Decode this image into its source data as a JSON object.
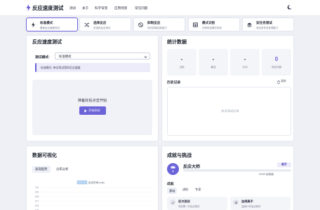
{
  "header": {
    "title": "反应速度测试",
    "nav": [
      "测试",
      "关于",
      "科学背景",
      "应用场景",
      "常见问题"
    ]
  },
  "modes": [
    {
      "title": "标准模式",
      "desc": "基础反应速度测试",
      "icon": "bolt-icon",
      "active": true
    },
    {
      "title": "选择反应",
      "desc": "多选择反应测试",
      "icon": "shuffle-icon",
      "active": false
    },
    {
      "title": "抑制反应",
      "desc": "测试抑制控制能力",
      "icon": "block-icon",
      "active": false
    },
    {
      "title": "模式识别",
      "desc": "识别特定模式测试",
      "icon": "table-icon",
      "active": false
    },
    {
      "title": "双任务测试",
      "desc": "测试多任务处理能力",
      "icon": "layers-icon",
      "active": false
    }
  ],
  "reaction": {
    "title": "反应速度测试",
    "mode_label": "测试模式:",
    "mode_value": "标准模式",
    "hint": "标准模式: 单次测试您的反应速度",
    "prompt": "准备好后点击开始",
    "start_label": "开始测试"
  },
  "stats": {
    "title": "统计数据",
    "items": [
      {
        "value": "-",
        "label": "当前"
      },
      {
        "value": "-",
        "label": "最佳"
      },
      {
        "value": "-",
        "label": "平均"
      },
      {
        "value": "0",
        "label": "测试次数"
      }
    ],
    "history_title": "历史记录",
    "clear_label": "清除",
    "empty_text": "尚无测试记录"
  },
  "viz": {
    "title": "数据可视化",
    "tabs": [
      "表现趋势",
      "分布分析"
    ],
    "active_tab": 0
  },
  "achievements": {
    "title": "成就与挑战",
    "level": "1",
    "level_name": "反应大师",
    "rank": "新手",
    "xp_text": "0/100 经验值",
    "xp_fraction": 0,
    "section_title": "成就",
    "tabs": [
      "基础",
      "进阶",
      "专家"
    ],
    "active_tab": 0,
    "cards": [
      {
        "title": "初次测试",
        "desc": "完成第一次反应测试",
        "icon": "check-icon"
      },
      {
        "title": "连续高手",
        "desc": "连续10次反应测试",
        "icon": "star-icon"
      }
    ]
  },
  "chart_data": {
    "type": "line",
    "legend": [
      "反应时间 (ms)"
    ],
    "legend_color": "#b9d6f2",
    "yticks": [
      "1.0",
      "0.9",
      "0.8",
      "0.7",
      "0.6",
      "0.5"
    ],
    "x": [],
    "series": [
      {
        "name": "反应时间 (ms)",
        "values": []
      }
    ],
    "ylim": [
      0,
      1
    ]
  },
  "colors": {
    "accent": "#6b63d8",
    "background": "#eef0f6",
    "panel": "#ffffff"
  }
}
